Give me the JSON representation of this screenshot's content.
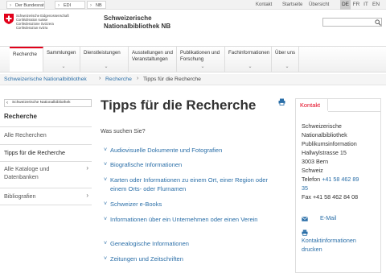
{
  "topbar": {
    "crumbs": [
      "Der Bundesrat",
      "EDI",
      "NB"
    ],
    "links": [
      "Kontakt",
      "Startseite",
      "Übersicht"
    ],
    "languages": [
      "DE",
      "FR",
      "IT",
      "EN"
    ],
    "active_language": "DE"
  },
  "header": {
    "confederation_lines": [
      "Schweizerische Eidgenossenschaft",
      "Confédération suisse",
      "Confederazione Svizzera",
      "Confederaziun svizra"
    ],
    "site_name_line1": "Schweizerische",
    "site_name_line2": "Nationalbibliothek NB",
    "search_placeholder": ""
  },
  "nav": {
    "items": [
      {
        "label": "Recherche",
        "active": true
      },
      {
        "label": "Sammlungen"
      },
      {
        "label": "Dienstleistungen"
      },
      {
        "label": "Ausstellungen und Veranstaltungen"
      },
      {
        "label": "Publikationen und Forschung"
      },
      {
        "label": "Fachinformationen"
      },
      {
        "label": "Über uns"
      }
    ]
  },
  "breadcrumb": {
    "items": [
      "Schweizerische Nationalbibliothek",
      "Recherche",
      "Tipps für die Recherche"
    ]
  },
  "sidebar": {
    "back_label": "Schweizerische Nationalbibliothek",
    "title": "Recherche",
    "items": [
      {
        "label": "Alle Recherchen"
      },
      {
        "label": "Tipps für die Recherche",
        "active": true
      },
      {
        "label": "Alle Kataloge und Datenbanken",
        "has_children": true
      },
      {
        "label": "Bibliografien",
        "has_children": true
      }
    ]
  },
  "main": {
    "title": "Tipps für die Recherche",
    "question": "Was suchen Sie?",
    "links": [
      "Audiovisuelle Dokumente und Fotografien",
      "Biografische Informationen",
      "Karten oder Informationen zu einem Ort, einer Region oder einem Orts- oder Flurnamen",
      "Schweizer e-Books",
      "Informationen über ein Unternehmen oder einen Verein",
      "Genealogische Informationen",
      "Zeitungen und Zeitschriften"
    ]
  },
  "contact": {
    "tab_label": "Kontakt",
    "lines": [
      "Schweizerische",
      "Nationalbibliothek",
      "Publikumsinformation",
      "Hallwylstrasse 15",
      "3003 Bern",
      "Schweiz"
    ],
    "phone_label": "Telefon",
    "phone": "+41 58 462 89",
    "phone_cont": "35",
    "fax": "Fax +41 58 462 84 08",
    "email_label": "E-Mail",
    "print_label_1": "Kontaktinformationen",
    "print_label_2": "drucken"
  },
  "colors": {
    "accent_red": "#e2001a",
    "link_blue": "#2b6fa8"
  }
}
